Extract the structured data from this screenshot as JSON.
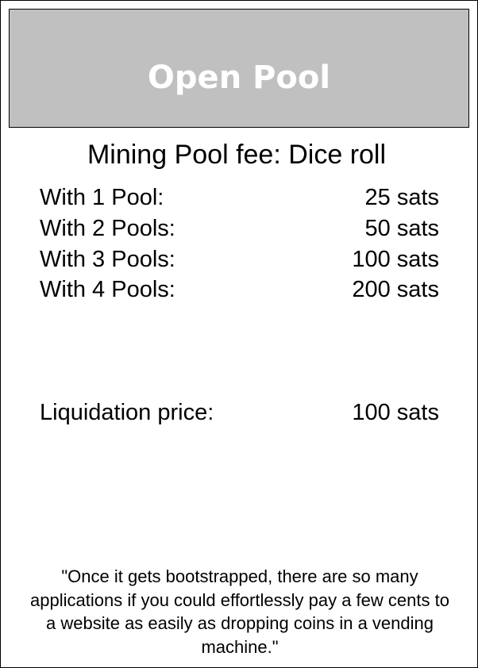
{
  "card": {
    "title": "Open Pool",
    "subtitle": "Mining Pool fee: Dice roll",
    "fees": [
      {
        "label": "With 1 Pool:",
        "value": "25 sats"
      },
      {
        "label": "With 2 Pools:",
        "value": "50 sats"
      },
      {
        "label": "With 3 Pools:",
        "value": "100 sats"
      },
      {
        "label": "With 4 Pools:",
        "value": "200 sats"
      }
    ],
    "liquidation": {
      "label": "Liquidation price:",
      "value": "100 sats"
    },
    "quote": "\"Once it gets bootstrapped, there are so many applications if you could effortlessly pay a few cents to a website as easily as dropping coins in a vending machine.\""
  },
  "colors": {
    "header_background": "#c0c0c0",
    "header_text": "#ffffff",
    "border": "#000000",
    "text": "#000000"
  }
}
